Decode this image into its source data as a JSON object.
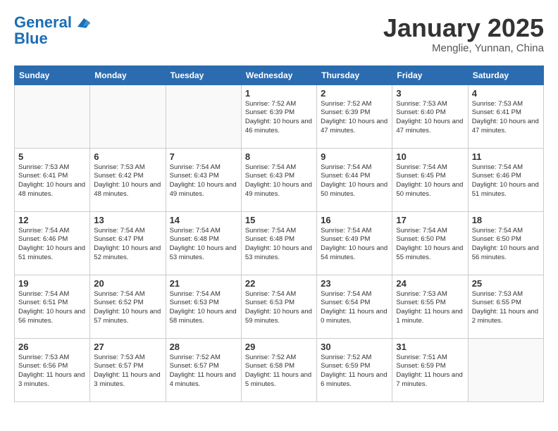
{
  "header": {
    "logo_line1": "General",
    "logo_line2": "Blue",
    "title": "January 2025",
    "subtitle": "Menglie, Yunnan, China"
  },
  "weekdays": [
    "Sunday",
    "Monday",
    "Tuesday",
    "Wednesday",
    "Thursday",
    "Friday",
    "Saturday"
  ],
  "weeks": [
    [
      {
        "day": "",
        "info": ""
      },
      {
        "day": "",
        "info": ""
      },
      {
        "day": "",
        "info": ""
      },
      {
        "day": "1",
        "info": "Sunrise: 7:52 AM\nSunset: 6:39 PM\nDaylight: 10 hours and 46 minutes."
      },
      {
        "day": "2",
        "info": "Sunrise: 7:52 AM\nSunset: 6:39 PM\nDaylight: 10 hours and 47 minutes."
      },
      {
        "day": "3",
        "info": "Sunrise: 7:53 AM\nSunset: 6:40 PM\nDaylight: 10 hours and 47 minutes."
      },
      {
        "day": "4",
        "info": "Sunrise: 7:53 AM\nSunset: 6:41 PM\nDaylight: 10 hours and 47 minutes."
      }
    ],
    [
      {
        "day": "5",
        "info": "Sunrise: 7:53 AM\nSunset: 6:41 PM\nDaylight: 10 hours and 48 minutes."
      },
      {
        "day": "6",
        "info": "Sunrise: 7:53 AM\nSunset: 6:42 PM\nDaylight: 10 hours and 48 minutes."
      },
      {
        "day": "7",
        "info": "Sunrise: 7:54 AM\nSunset: 6:43 PM\nDaylight: 10 hours and 49 minutes."
      },
      {
        "day": "8",
        "info": "Sunrise: 7:54 AM\nSunset: 6:43 PM\nDaylight: 10 hours and 49 minutes."
      },
      {
        "day": "9",
        "info": "Sunrise: 7:54 AM\nSunset: 6:44 PM\nDaylight: 10 hours and 50 minutes."
      },
      {
        "day": "10",
        "info": "Sunrise: 7:54 AM\nSunset: 6:45 PM\nDaylight: 10 hours and 50 minutes."
      },
      {
        "day": "11",
        "info": "Sunrise: 7:54 AM\nSunset: 6:46 PM\nDaylight: 10 hours and 51 minutes."
      }
    ],
    [
      {
        "day": "12",
        "info": "Sunrise: 7:54 AM\nSunset: 6:46 PM\nDaylight: 10 hours and 51 minutes."
      },
      {
        "day": "13",
        "info": "Sunrise: 7:54 AM\nSunset: 6:47 PM\nDaylight: 10 hours and 52 minutes."
      },
      {
        "day": "14",
        "info": "Sunrise: 7:54 AM\nSunset: 6:48 PM\nDaylight: 10 hours and 53 minutes."
      },
      {
        "day": "15",
        "info": "Sunrise: 7:54 AM\nSunset: 6:48 PM\nDaylight: 10 hours and 53 minutes."
      },
      {
        "day": "16",
        "info": "Sunrise: 7:54 AM\nSunset: 6:49 PM\nDaylight: 10 hours and 54 minutes."
      },
      {
        "day": "17",
        "info": "Sunrise: 7:54 AM\nSunset: 6:50 PM\nDaylight: 10 hours and 55 minutes."
      },
      {
        "day": "18",
        "info": "Sunrise: 7:54 AM\nSunset: 6:50 PM\nDaylight: 10 hours and 56 minutes."
      }
    ],
    [
      {
        "day": "19",
        "info": "Sunrise: 7:54 AM\nSunset: 6:51 PM\nDaylight: 10 hours and 56 minutes."
      },
      {
        "day": "20",
        "info": "Sunrise: 7:54 AM\nSunset: 6:52 PM\nDaylight: 10 hours and 57 minutes."
      },
      {
        "day": "21",
        "info": "Sunrise: 7:54 AM\nSunset: 6:53 PM\nDaylight: 10 hours and 58 minutes."
      },
      {
        "day": "22",
        "info": "Sunrise: 7:54 AM\nSunset: 6:53 PM\nDaylight: 10 hours and 59 minutes."
      },
      {
        "day": "23",
        "info": "Sunrise: 7:54 AM\nSunset: 6:54 PM\nDaylight: 11 hours and 0 minutes."
      },
      {
        "day": "24",
        "info": "Sunrise: 7:53 AM\nSunset: 6:55 PM\nDaylight: 11 hours and 1 minute."
      },
      {
        "day": "25",
        "info": "Sunrise: 7:53 AM\nSunset: 6:55 PM\nDaylight: 11 hours and 2 minutes."
      }
    ],
    [
      {
        "day": "26",
        "info": "Sunrise: 7:53 AM\nSunset: 6:56 PM\nDaylight: 11 hours and 3 minutes."
      },
      {
        "day": "27",
        "info": "Sunrise: 7:53 AM\nSunset: 6:57 PM\nDaylight: 11 hours and 3 minutes."
      },
      {
        "day": "28",
        "info": "Sunrise: 7:52 AM\nSunset: 6:57 PM\nDaylight: 11 hours and 4 minutes."
      },
      {
        "day": "29",
        "info": "Sunrise: 7:52 AM\nSunset: 6:58 PM\nDaylight: 11 hours and 5 minutes."
      },
      {
        "day": "30",
        "info": "Sunrise: 7:52 AM\nSunset: 6:59 PM\nDaylight: 11 hours and 6 minutes."
      },
      {
        "day": "31",
        "info": "Sunrise: 7:51 AM\nSunset: 6:59 PM\nDaylight: 11 hours and 7 minutes."
      },
      {
        "day": "",
        "info": ""
      }
    ]
  ]
}
